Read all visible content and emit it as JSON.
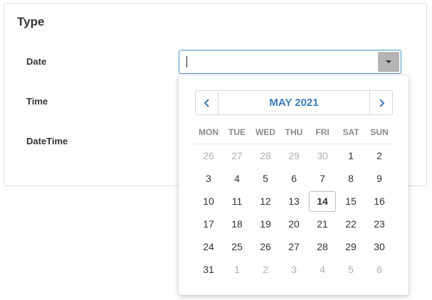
{
  "panel": {
    "title": "Type",
    "fields": {
      "date_label": "Date",
      "time_label": "Time",
      "datetime_label": "DateTime"
    }
  },
  "date_input": {
    "value": "",
    "dropdown_icon": "caret-down-icon"
  },
  "calendar": {
    "month_title": "MAY 2021",
    "prev_icon": "chevron-left-icon",
    "next_icon": "chevron-right-icon",
    "weekdays": [
      "MON",
      "TUE",
      "WED",
      "THU",
      "FRI",
      "SAT",
      "SUN"
    ],
    "weeks": [
      [
        {
          "d": "26",
          "other": true
        },
        {
          "d": "27",
          "other": true
        },
        {
          "d": "28",
          "other": true
        },
        {
          "d": "29",
          "other": true
        },
        {
          "d": "30",
          "other": true
        },
        {
          "d": "1"
        },
        {
          "d": "2"
        }
      ],
      [
        {
          "d": "3"
        },
        {
          "d": "4"
        },
        {
          "d": "5"
        },
        {
          "d": "6"
        },
        {
          "d": "7"
        },
        {
          "d": "8"
        },
        {
          "d": "9"
        }
      ],
      [
        {
          "d": "10"
        },
        {
          "d": "11"
        },
        {
          "d": "12"
        },
        {
          "d": "13"
        },
        {
          "d": "14",
          "today": true
        },
        {
          "d": "15"
        },
        {
          "d": "16"
        }
      ],
      [
        {
          "d": "17"
        },
        {
          "d": "18"
        },
        {
          "d": "19"
        },
        {
          "d": "20"
        },
        {
          "d": "21"
        },
        {
          "d": "22"
        },
        {
          "d": "23"
        }
      ],
      [
        {
          "d": "24"
        },
        {
          "d": "25"
        },
        {
          "d": "26"
        },
        {
          "d": "27"
        },
        {
          "d": "28"
        },
        {
          "d": "29"
        },
        {
          "d": "30"
        }
      ],
      [
        {
          "d": "31"
        },
        {
          "d": "1",
          "other": true
        },
        {
          "d": "2",
          "other": true
        },
        {
          "d": "3",
          "other": true
        },
        {
          "d": "4",
          "other": true
        },
        {
          "d": "5",
          "other": true
        },
        {
          "d": "6",
          "other": true
        }
      ]
    ],
    "colors": {
      "accent": "#3a7cbd",
      "other_month": "#b0b0b0"
    }
  }
}
